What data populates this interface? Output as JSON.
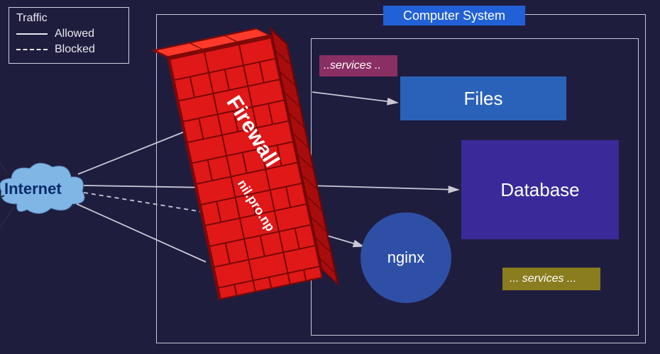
{
  "legend": {
    "title": "Traffic",
    "allowed": "Allowed",
    "blocked": "Blocked"
  },
  "internet": {
    "label": "Internet"
  },
  "firewall": {
    "label": "Firewall",
    "sublabel": "nil.pro.np"
  },
  "system": {
    "title": "Computer System",
    "services_top": "..services ..",
    "files": "Files",
    "database": "Database",
    "nginx": "nginx",
    "services_bottom": "... services ..."
  },
  "colors": {
    "bg": "#1f1d3e",
    "accent_blue": "#2160d6",
    "firewall_red": "#e01818",
    "db_purple": "#3a2a99",
    "files_blue": "#2a62b9",
    "nginx_blue": "#2f4fa6",
    "services_magenta": "#8a2f63",
    "services_olive": "#8a7d1f"
  }
}
